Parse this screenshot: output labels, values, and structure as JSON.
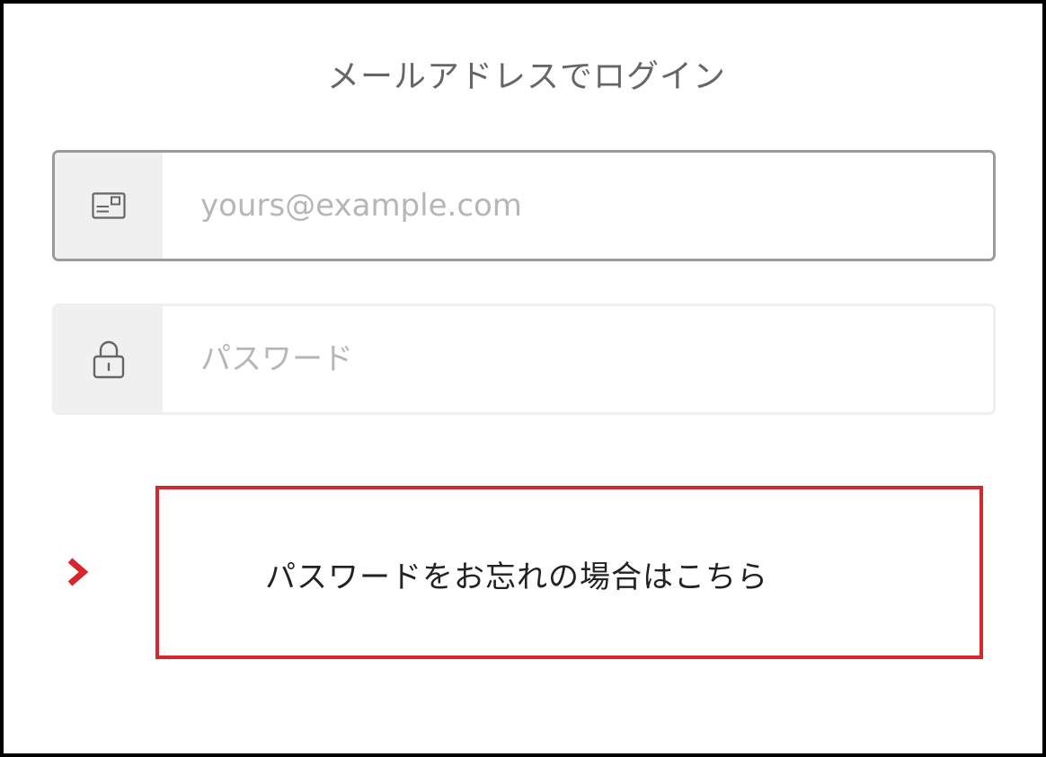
{
  "title": "メールアドレスでログイン",
  "email": {
    "icon": "id-card-icon",
    "placeholder": "yours@example.com",
    "value": ""
  },
  "password": {
    "icon": "lock-icon",
    "placeholder": "パスワード",
    "value": ""
  },
  "forgot": {
    "icon": "chevron-right-icon",
    "label": "パスワードをお忘れの場合はこちら"
  },
  "colors": {
    "accent": "#d7262c",
    "field_border_active": "#9a9a9a",
    "icon_cell_bg": "#f0f0f0",
    "placeholder": "#b6b6b6"
  }
}
